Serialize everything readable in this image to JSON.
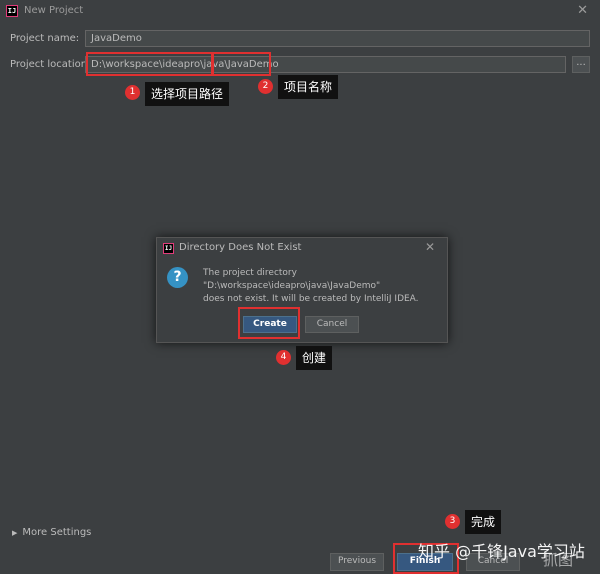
{
  "window": {
    "title": "New Project",
    "logo_text": "IJ"
  },
  "form": {
    "name_label": "Project name:",
    "name_value": "JavaDemo",
    "location_label": "Project location:",
    "location_value": "D:\\workspace\\ideapro\\java\\JavaDemo",
    "browse_label": "..."
  },
  "annotations": [
    {
      "number": "1",
      "text": "选择项目路径"
    },
    {
      "number": "2",
      "text": "项目名称"
    },
    {
      "number": "3",
      "text": "完成"
    },
    {
      "number": "4",
      "text": "创建"
    }
  ],
  "dialog": {
    "title": "Directory Does Not Exist",
    "line1": "The project directory",
    "line2": "\"D:\\workspace\\ideapro\\java\\JavaDemo\"",
    "line3": "does not exist. It will be created by IntelliJ IDEA.",
    "create_label": "Create",
    "cancel_label": "Cancel"
  },
  "footer": {
    "more_settings": "More Settings",
    "previous_label": "Previous",
    "finish_label": "Finish",
    "cancel_label": "Cancel"
  },
  "watermark": {
    "text": "知乎 @千锋Java学习站",
    "corner": "抓图"
  },
  "colors": {
    "background": "#3c3f41",
    "accent": "#365880",
    "annotation_red": "#e03030"
  }
}
